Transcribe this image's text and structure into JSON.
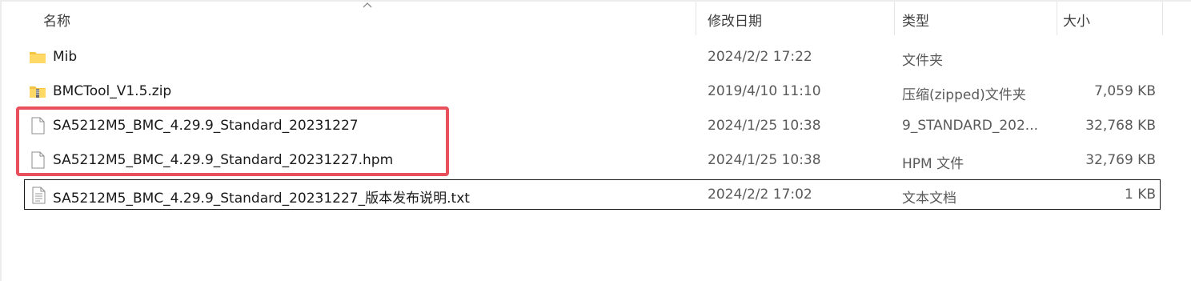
{
  "header": {
    "name_label": "名称",
    "modified_label": "修改日期",
    "type_label": "类型",
    "size_label": "大小"
  },
  "files": [
    {
      "name": "Mib",
      "modified": "2024/2/2 17:22",
      "type": "文件夹",
      "size": "",
      "icon": "folder-icon"
    },
    {
      "name": "BMCTool_V1.5.zip",
      "modified": "2019/4/10 11:10",
      "type": "压缩(zipped)文件夹",
      "size": "7,059 KB",
      "icon": "zip-folder-icon"
    },
    {
      "name": "SA5212M5_BMC_4.29.9_Standard_20231227",
      "modified": "2024/1/25 10:38",
      "type": "9_STANDARD_202...",
      "size": "32,768 KB",
      "icon": "file-icon"
    },
    {
      "name": "SA5212M5_BMC_4.29.9_Standard_20231227.hpm",
      "modified": "2024/1/25 10:38",
      "type": "HPM 文件",
      "size": "32,769 KB",
      "icon": "file-icon"
    },
    {
      "name": "SA5212M5_BMC_4.29.9_Standard_20231227_版本发布说明.txt",
      "modified": "2024/2/2 17:02",
      "type": "文本文档",
      "size": "1 KB",
      "icon": "text-file-icon"
    }
  ],
  "colors": {
    "highlight": "#e8505b",
    "folder": "#f4c542"
  }
}
